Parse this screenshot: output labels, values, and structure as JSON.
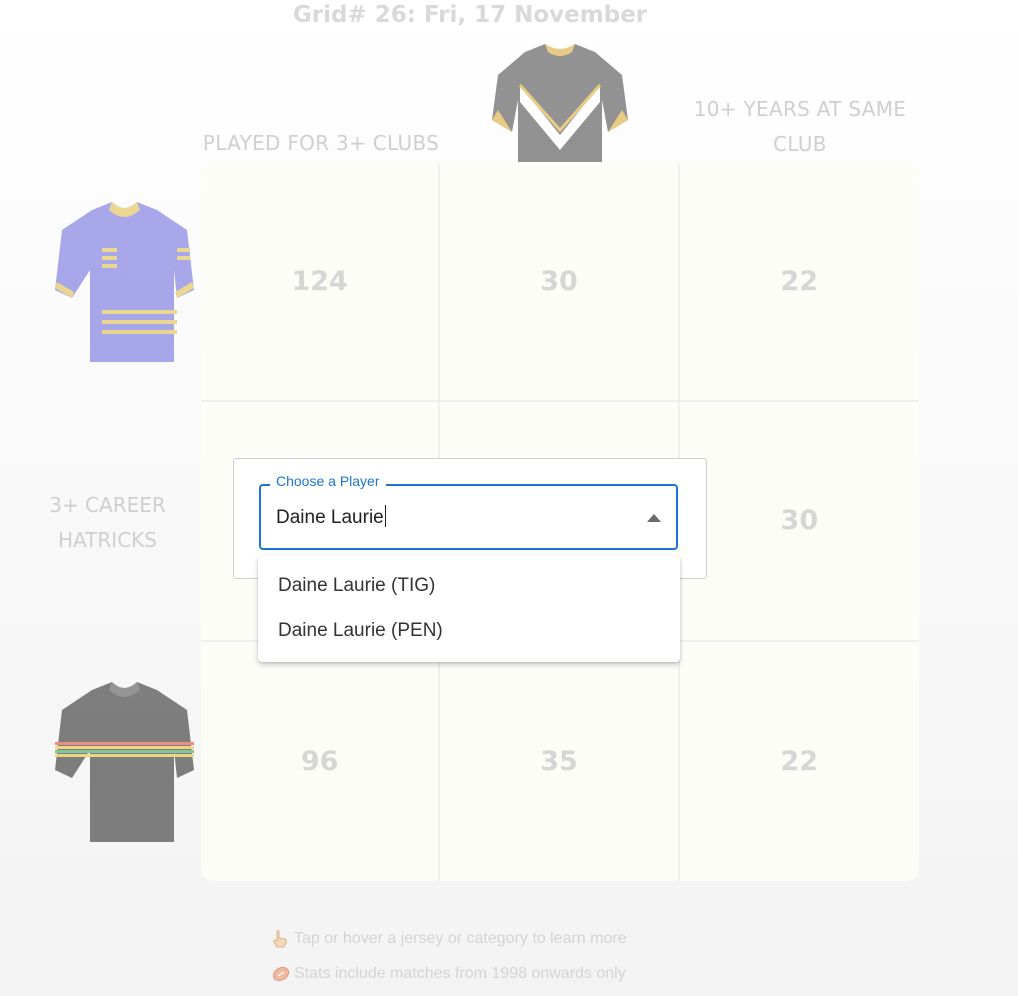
{
  "title": "Grid# 26: Fri, 17 November",
  "columns": [
    {
      "label": "PLAYED FOR 3+ CLUBS"
    },
    {
      "jersey": "storm-jersey-icon"
    },
    {
      "label_line1": "10+ YEARS AT SAME",
      "label_line2": "CLUB"
    }
  ],
  "rows": [
    {
      "jersey": "eels-jersey-icon"
    },
    {
      "label_line1": "3+ CAREER",
      "label_line2": "HATRICKS"
    },
    {
      "jersey": "panthers-jersey-icon"
    }
  ],
  "grid": [
    [
      "124",
      "30",
      "22"
    ],
    [
      "",
      "",
      "30"
    ],
    [
      "96",
      "35",
      "22"
    ]
  ],
  "player_search": {
    "label": "Choose a Player",
    "value": "Daine Laurie",
    "options": [
      "Daine Laurie (TIG)",
      "Daine Laurie (PEN)"
    ]
  },
  "footer": {
    "tip1": "Tap or hover a jersey or category to learn more",
    "tip2": "Stats include matches from 1998 onwards only",
    "icon1": "pointing-hand-icon",
    "icon2": "football-icon"
  },
  "colors": {
    "accent": "#1976d2",
    "cell_bg": "#fdfdf8",
    "muted_text": "#d6d6d6"
  }
}
